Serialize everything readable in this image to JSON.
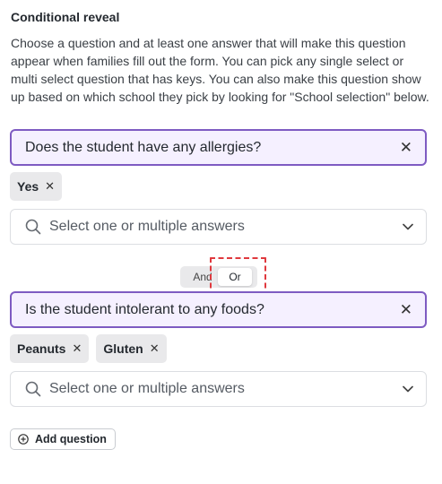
{
  "section": {
    "title": "Conditional reveal",
    "description": "Choose a question and at least one answer that will make this question appear when families fill out the form. You can pick any single select or multi select question that has keys. You can also make this question show up based on which school they pick by looking for \"School selection\" below."
  },
  "conditions": [
    {
      "question": "Does the student have any allergies?",
      "answers": [
        "Yes"
      ],
      "select_placeholder": "Select one or multiple answers"
    },
    {
      "question": "Is the student intolerant to any foods?",
      "answers": [
        "Peanuts",
        "Gluten"
      ],
      "select_placeholder": "Select one or multiple answers"
    }
  ],
  "logic_toggle": {
    "options": [
      "And",
      "Or"
    ],
    "selected": "Or"
  },
  "add_question_label": "Add question",
  "icons": {
    "remove": "close-icon",
    "search": "search-icon",
    "dropdown": "chevron-down-icon",
    "add": "plus-circle-icon"
  },
  "colors": {
    "question_border": "#7e5bc2",
    "question_bg": "#f5f0ff",
    "chip_bg": "#e9e9eb",
    "highlight_dash": "#e0393e"
  }
}
